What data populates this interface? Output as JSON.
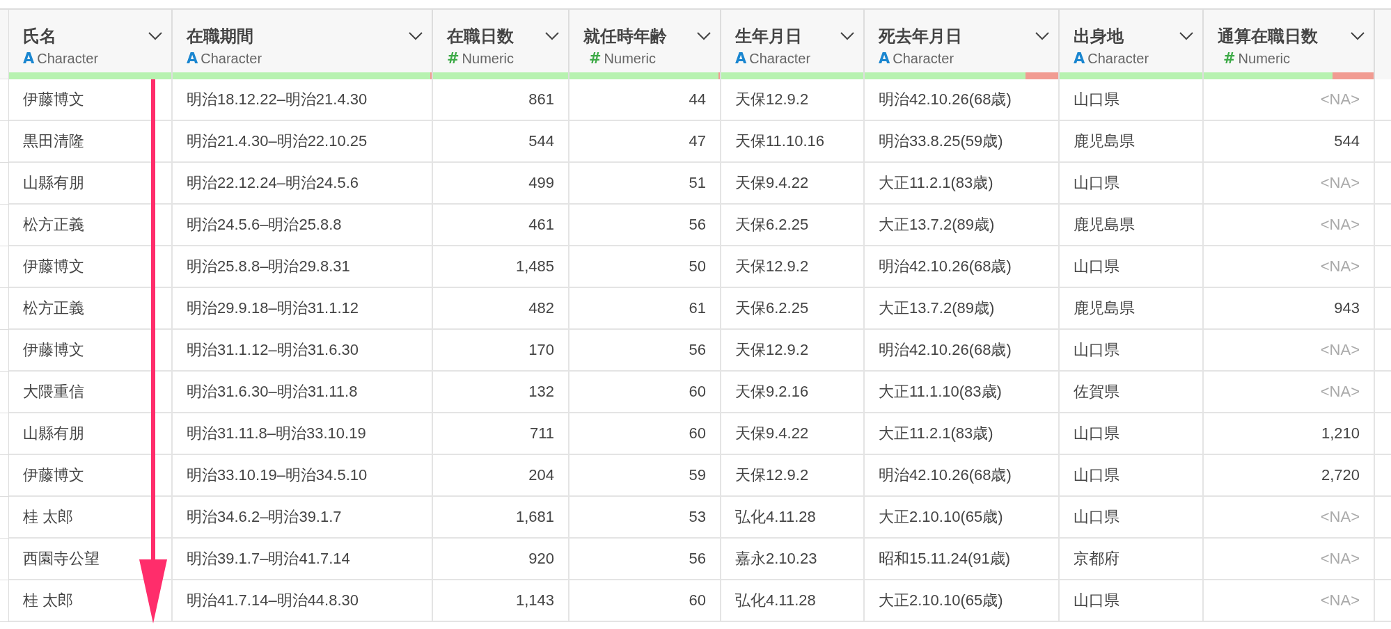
{
  "columns": [
    {
      "name": "氏名",
      "kind": "character",
      "icon": "A",
      "type": "Character",
      "quality": {
        "level": 1
      }
    },
    {
      "name": "在職期間",
      "kind": "character",
      "icon": "A",
      "type": "Character",
      "quality": {
        "level": 0.995
      }
    },
    {
      "name": "在職日数",
      "kind": "numeric",
      "icon": "#",
      "type": "Numeric",
      "quality": {
        "level": 1
      }
    },
    {
      "name": "就任時年齢",
      "kind": "numeric",
      "icon": "#",
      "type": "Numeric",
      "quality": {
        "level": 0.99
      }
    },
    {
      "name": "生年月日",
      "kind": "character",
      "icon": "A",
      "type": "Character",
      "quality": {
        "level": 1
      }
    },
    {
      "name": "死去年月日",
      "kind": "character",
      "icon": "A",
      "type": "Character",
      "quality": {
        "level": 0.83
      }
    },
    {
      "name": "出身地",
      "kind": "character",
      "icon": "A",
      "type": "Character",
      "quality": {
        "level": 1
      }
    },
    {
      "name": "通算在職日数",
      "kind": "numeric",
      "icon": "#",
      "type": "Numeric",
      "quality": {
        "level": 0.76
      }
    }
  ],
  "rows": [
    [
      "伊藤博文",
      "明治18.12.22–明治21.4.30",
      "861",
      "44",
      "天保12.9.2",
      "明治42.10.26(68歳)",
      "山口県",
      "<NA>"
    ],
    [
      "黒田清隆",
      "明治21.4.30–明治22.10.25",
      "544",
      "47",
      "天保11.10.16",
      "明治33.8.25(59歳)",
      "鹿児島県",
      "544"
    ],
    [
      "山縣有朋",
      "明治22.12.24–明治24.5.6",
      "499",
      "51",
      "天保9.4.22",
      "大正11.2.1(83歳)",
      "山口県",
      "<NA>"
    ],
    [
      "松方正義",
      "明治24.5.6–明治25.8.8",
      "461",
      "56",
      "天保6.2.25",
      "大正13.7.2(89歳)",
      "鹿児島県",
      "<NA>"
    ],
    [
      "伊藤博文",
      "明治25.8.8–明治29.8.31",
      "1,485",
      "50",
      "天保12.9.2",
      "明治42.10.26(68歳)",
      "山口県",
      "<NA>"
    ],
    [
      "松方正義",
      "明治29.9.18–明治31.1.12",
      "482",
      "61",
      "天保6.2.25",
      "大正13.7.2(89歳)",
      "鹿児島県",
      "943"
    ],
    [
      "伊藤博文",
      "明治31.1.12–明治31.6.30",
      "170",
      "56",
      "天保12.9.2",
      "明治42.10.26(68歳)",
      "山口県",
      "<NA>"
    ],
    [
      "大隈重信",
      "明治31.6.30–明治31.11.8",
      "132",
      "60",
      "天保9.2.16",
      "大正11.1.10(83歳)",
      "佐賀県",
      "<NA>"
    ],
    [
      "山縣有朋",
      "明治31.11.8–明治33.10.19",
      "711",
      "60",
      "天保9.4.22",
      "大正11.2.1(83歳)",
      "山口県",
      "1,210"
    ],
    [
      "伊藤博文",
      "明治33.10.19–明治34.5.10",
      "204",
      "59",
      "天保12.9.2",
      "明治42.10.26(68歳)",
      "山口県",
      "2,720"
    ],
    [
      "桂 太郎",
      "明治34.6.2–明治39.1.7",
      "1,681",
      "53",
      "弘化4.11.28",
      "大正2.10.10(65歳)",
      "山口県",
      "<NA>"
    ],
    [
      "西園寺公望",
      "明治39.1.7–明治41.7.14",
      "920",
      "56",
      "嘉永2.10.23",
      "昭和15.11.24(91歳)",
      "京都府",
      "<NA>"
    ],
    [
      "桂 太郎",
      "明治41.7.14–明治44.8.30",
      "1,143",
      "60",
      "弘化4.11.28",
      "大正2.10.10(65歳)",
      "山口県",
      "<NA>"
    ]
  ],
  "missing": [
    [
      false,
      false,
      false,
      false,
      false,
      false,
      false,
      true
    ],
    [
      false,
      false,
      false,
      false,
      false,
      false,
      false,
      false
    ],
    [
      false,
      false,
      false,
      false,
      false,
      false,
      false,
      true
    ],
    [
      false,
      false,
      false,
      false,
      false,
      false,
      false,
      true
    ],
    [
      false,
      false,
      false,
      false,
      false,
      false,
      false,
      true
    ],
    [
      false,
      false,
      false,
      false,
      false,
      false,
      false,
      false
    ],
    [
      false,
      false,
      false,
      false,
      false,
      false,
      false,
      true
    ],
    [
      false,
      false,
      false,
      false,
      false,
      false,
      false,
      true
    ],
    [
      false,
      false,
      false,
      false,
      false,
      false,
      false,
      false
    ],
    [
      false,
      false,
      false,
      false,
      false,
      false,
      false,
      false
    ],
    [
      false,
      false,
      false,
      false,
      false,
      false,
      false,
      true
    ],
    [
      false,
      false,
      false,
      false,
      false,
      false,
      false,
      true
    ],
    [
      false,
      false,
      false,
      false,
      false,
      false,
      false,
      true
    ]
  ]
}
